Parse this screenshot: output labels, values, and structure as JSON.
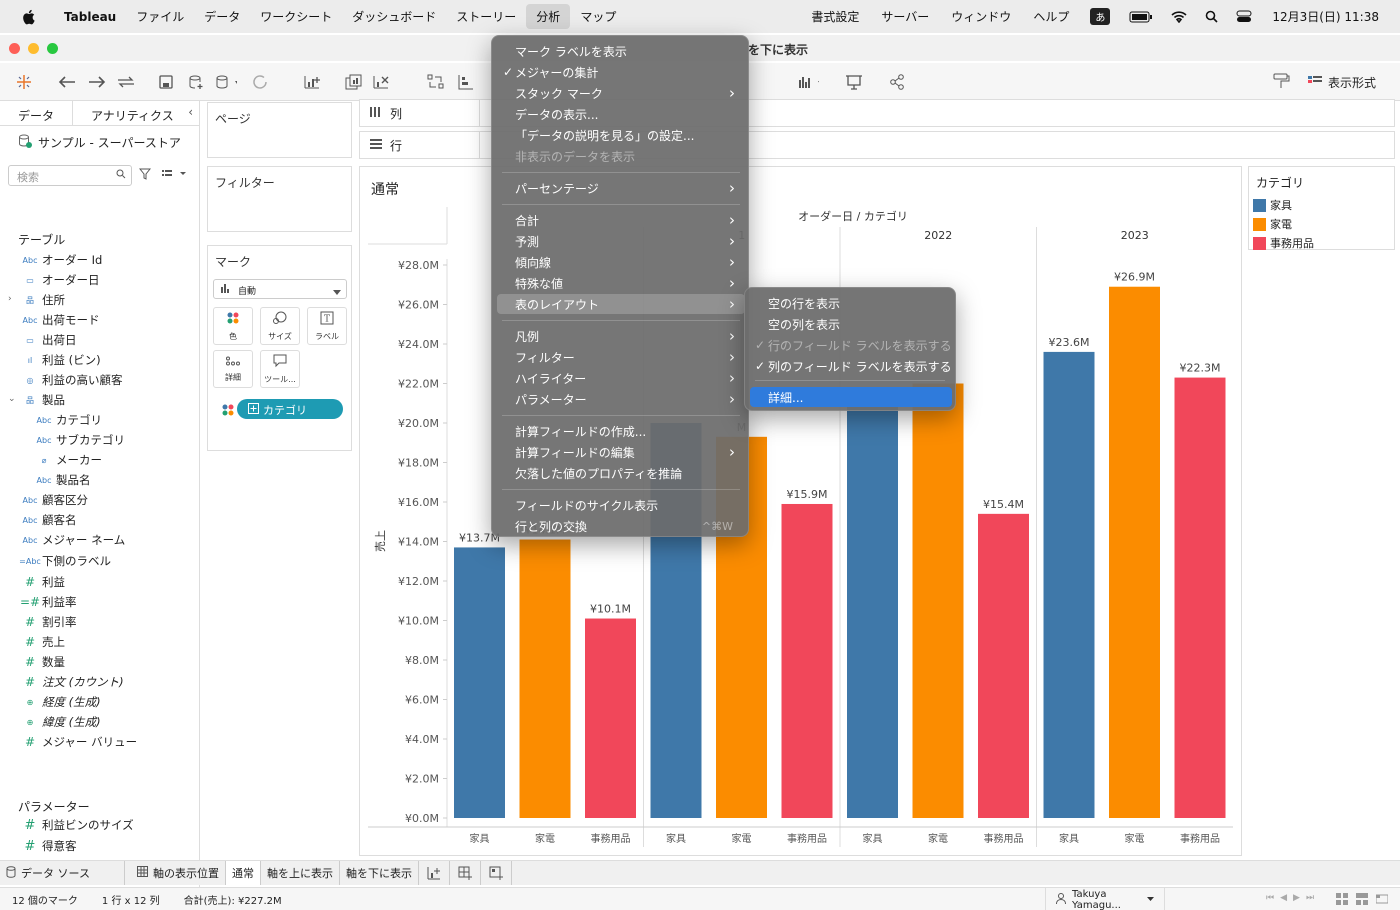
{
  "menubar": {
    "app_name": "Tableau",
    "items": [
      "ファイル",
      "データ",
      "ワークシート",
      "ダッシュボード",
      "ストーリー",
      "分析",
      "マップ"
    ],
    "right_items": [
      "書式設定",
      "サーバー",
      "ウィンドウ",
      "ヘルプ"
    ],
    "ime": "あ",
    "clock": "12月3日(日) 11:38"
  },
  "window": {
    "title": "を下に表示"
  },
  "toolbar": {
    "format_label": "表示形式"
  },
  "left_pane": {
    "tabs": [
      "データ",
      "アナリティクス"
    ],
    "datasource": "サンプル - スーパーストア",
    "search_placeholder": "検索",
    "tables_header": "テーブル",
    "fields": [
      {
        "icon": "Abc",
        "label": "オーダー Id",
        "indent": 0
      },
      {
        "icon": "date",
        "label": "オーダー日",
        "indent": 0
      },
      {
        "icon": "hier",
        "label": "住所",
        "indent": 0
      },
      {
        "icon": "Abc",
        "label": "出荷モード",
        "indent": 0
      },
      {
        "icon": "date",
        "label": "出荷日",
        "indent": 0
      },
      {
        "icon": "bin",
        "label": "利益 (ビン)",
        "indent": 0
      },
      {
        "icon": "set",
        "label": "利益の高い顧客",
        "indent": 0
      },
      {
        "icon": "hier",
        "label": "製品",
        "indent": 0
      },
      {
        "icon": "Abc",
        "label": "カテゴリ",
        "indent": 1
      },
      {
        "icon": "Abc",
        "label": "サブカテゴリ",
        "indent": 1
      },
      {
        "icon": "clip",
        "label": "メーカー",
        "indent": 1
      },
      {
        "icon": "Abc",
        "label": "製品名",
        "indent": 1
      },
      {
        "icon": "Abc",
        "label": "顧客区分",
        "indent": 0
      },
      {
        "icon": "Abc",
        "label": "顧客名",
        "indent": 0
      },
      {
        "icon": "Abc",
        "label": "メジャー ネーム",
        "indent": 0
      },
      {
        "icon": "=Abc",
        "label": "下側のラベル",
        "indent": 0
      },
      {
        "icon": "#",
        "label": "利益",
        "indent": 0
      },
      {
        "icon": "=#",
        "label": "利益率",
        "indent": 0
      },
      {
        "icon": "#",
        "label": "割引率",
        "indent": 0
      },
      {
        "icon": "#",
        "label": "売上",
        "indent": 0
      },
      {
        "icon": "#",
        "label": "数量",
        "indent": 0
      },
      {
        "icon": "#",
        "label": "注文 (カウント)",
        "indent": 0
      },
      {
        "icon": "globe",
        "label": "経度 (生成)",
        "indent": 0
      },
      {
        "icon": "globe",
        "label": "緯度 (生成)",
        "indent": 0
      },
      {
        "icon": "#",
        "label": "メジャー バリュー",
        "indent": 0
      }
    ],
    "params_header": "パラメーター",
    "params": [
      "利益ビンのサイズ",
      "得意客"
    ]
  },
  "shelves": {
    "pages": "ページ",
    "filters": "フィルター",
    "marks": "マーク",
    "marks_type": "自動",
    "mark_buttons": [
      "色",
      "サイズ",
      "ラベル",
      "詳細",
      "ツール..."
    ],
    "color_pill": "カテゴリ",
    "columns": "列",
    "rows": "行"
  },
  "viz": {
    "title": "通常"
  },
  "legend": {
    "title": "カテゴリ",
    "items": [
      {
        "label": "家具",
        "color": "#3f78a9"
      },
      {
        "label": "家電",
        "color": "#fb8c00"
      },
      {
        "label": "事務用品",
        "color": "#f1475a"
      }
    ]
  },
  "chart_data": {
    "type": "bar",
    "header": "オーダー日 / カテゴリ",
    "ylabel": "売上",
    "ylim": [
      0,
      28
    ],
    "yticks": [
      "¥0.0M",
      "¥2.0M",
      "¥4.0M",
      "¥6.0M",
      "¥8.0M",
      "¥10.0M",
      "¥12.0M",
      "¥14.0M",
      "¥16.0M",
      "¥18.0M",
      "¥20.0M",
      "¥22.0M",
      "¥24.0M",
      "¥26.0M",
      "¥28.0M"
    ],
    "categories": [
      "家具",
      "家電",
      "事務用品"
    ],
    "groups": [
      {
        "year": "",
        "values": [
          13.7,
          14.1,
          10.1
        ],
        "labels": [
          "¥13.7M",
          "¥14.1M",
          "¥10.1M"
        ]
      },
      {
        "year": "1",
        "values": [
          20.0,
          19.3,
          15.9
        ],
        "labels": [
          "",
          "M",
          "¥15.9M"
        ]
      },
      {
        "year": "2022",
        "values": [
          21.0,
          22.0,
          15.4
        ],
        "labels": [
          "",
          "",
          "¥15.4M"
        ]
      },
      {
        "year": "2023",
        "values": [
          23.6,
          26.9,
          22.3
        ],
        "labels": [
          "¥23.6M",
          "¥26.9M",
          "¥22.3M"
        ]
      }
    ]
  },
  "bottom_tabs": {
    "datasource": "データ ソース",
    "sheets": [
      "軸の表示位置",
      "通常",
      "軸を上に表示",
      "軸を下に表示"
    ]
  },
  "status": {
    "marks": "12 個のマーク",
    "dims": "1 行 x 12 列",
    "sum": "合計(売上): ¥227.2M",
    "user": "Takuya Yamagu..."
  },
  "menu": {
    "items": [
      {
        "label": "マーク ラベルを表示"
      },
      {
        "label": "メジャーの集計",
        "checked": true
      },
      {
        "label": "スタック マーク",
        "arrow": true
      },
      {
        "label": "データの表示..."
      },
      {
        "label": "「データの説明を見る」の設定..."
      },
      {
        "label": "非表示のデータを表示",
        "disabled": true
      },
      {
        "sep": true
      },
      {
        "label": "パーセンテージ",
        "arrow": true
      },
      {
        "sep": true
      },
      {
        "label": "合計",
        "arrow": true
      },
      {
        "label": "予測",
        "arrow": true
      },
      {
        "label": "傾向線",
        "arrow": true
      },
      {
        "label": "特殊な値",
        "arrow": true
      },
      {
        "label": "表のレイアウト",
        "arrow": true,
        "highlight": true
      },
      {
        "sep": true
      },
      {
        "label": "凡例",
        "arrow": true
      },
      {
        "label": "フィルター",
        "arrow": true
      },
      {
        "label": "ハイライター",
        "arrow": true
      },
      {
        "label": "パラメーター",
        "arrow": true
      },
      {
        "sep": true
      },
      {
        "label": "計算フィールドの作成..."
      },
      {
        "label": "計算フィールドの編集",
        "arrow": true
      },
      {
        "label": "欠落した値のプロパティを推論"
      },
      {
        "sep": true
      },
      {
        "label": "フィールドのサイクル表示"
      },
      {
        "label": "行と列の交換",
        "shortcut": "^⌘W"
      }
    ]
  },
  "submenu": {
    "items": [
      {
        "label": "空の行を表示"
      },
      {
        "label": "空の列を表示"
      },
      {
        "label": "行のフィールド ラベルを表示する",
        "checked": true,
        "disabled": true
      },
      {
        "label": "列のフィールド ラベルを表示する",
        "checked": true
      },
      {
        "sep": true
      },
      {
        "label": "詳細...",
        "selected": true
      }
    ]
  }
}
